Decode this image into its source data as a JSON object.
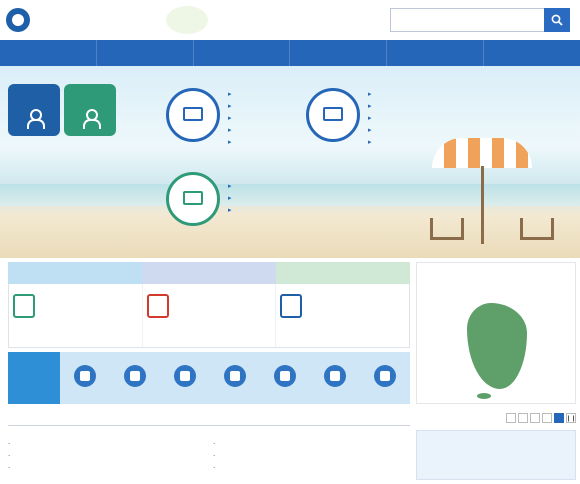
{
  "header": {
    "logo_line1": "",
    "logo_line2": "",
    "gov_label": "",
    "search_placeholder": ""
  },
  "nav": [
    "",
    "",
    "",
    "",
    "",
    ""
  ],
  "hero": {
    "login_personal": "",
    "login_business": "",
    "title": "",
    "subtitle": "",
    "circles": [
      "",
      "",
      ""
    ],
    "list1": [
      "",
      "",
      "",
      "",
      ""
    ],
    "list2": [
      "",
      "",
      "",
      "",
      ""
    ],
    "list3": [
      "",
      "",
      ""
    ]
  },
  "services": {
    "tabs": [
      "",
      "",
      ""
    ],
    "col1": [
      "",
      "",
      ""
    ],
    "col2": [
      "",
      "",
      ""
    ],
    "col3": [
      "",
      "",
      "",
      ""
    ]
  },
  "help": {
    "label": "",
    "items": [
      "",
      "",
      "",
      "",
      "",
      "",
      ""
    ]
  },
  "map": {
    "title": "",
    "hint": ""
  },
  "notice": {
    "title": "",
    "more": "",
    "rows": [
      {
        "text": "",
        "date": ""
      },
      {
        "text": "",
        "date": ""
      },
      {
        "text": "",
        "date": ""
      },
      {
        "text": "",
        "date": ""
      },
      {
        "text": "",
        "date": ""
      },
      {
        "text": "",
        "date": ""
      }
    ]
  },
  "popup": {
    "title": "",
    "pages": [
      "",
      "",
      "",
      "",
      ""
    ],
    "banner_line1": "",
    "banner_line2": ""
  }
}
